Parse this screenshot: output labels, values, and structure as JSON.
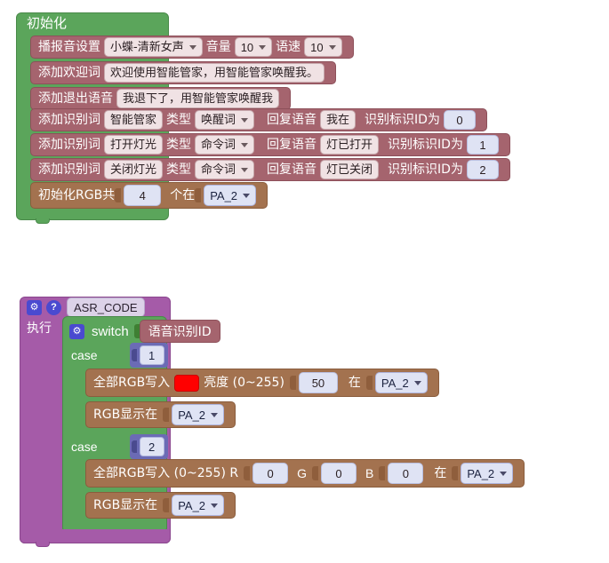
{
  "app": {
    "type": "block-programming-canvas",
    "background": "#ffffff"
  },
  "colors": {
    "hat_green": "#5ba55b",
    "speech_maroon": "#a5646e",
    "rgb_brown": "#a3724f",
    "event_purple": "#a55ba8",
    "value_blue": "#dfe3f4",
    "red_swatch": "#ff0000"
  },
  "groups": [
    {
      "id": "init-group",
      "hat": {
        "label": "初始化"
      },
      "statements": [
        {
          "id": "voice-setting",
          "label": "播报音设置",
          "fields": [
            {
              "kind": "dropdown",
              "value": "小蝶-清新女声"
            },
            {
              "kind": "label",
              "value": "音量"
            },
            {
              "kind": "dropdown",
              "value": "10"
            },
            {
              "kind": "label",
              "value": "语速"
            },
            {
              "kind": "dropdown",
              "value": "10"
            }
          ]
        },
        {
          "id": "welcome-word",
          "label": "添加欢迎词",
          "fields": [
            {
              "kind": "text",
              "value": "欢迎使用智能管家，用智能管家唤醒我。"
            }
          ]
        },
        {
          "id": "exit-voice",
          "label": "添加退出语音",
          "fields": [
            {
              "kind": "text",
              "value": "我退下了，用智能管家唤醒我"
            }
          ]
        },
        {
          "id": "keyword-0",
          "label": "添加识别词",
          "fields": [
            {
              "kind": "text",
              "value": "智能管家"
            },
            {
              "kind": "label",
              "value": "类型"
            },
            {
              "kind": "dropdown",
              "value": "唤醒词"
            },
            {
              "kind": "label",
              "value": "回复语音"
            },
            {
              "kind": "text",
              "value": "我在"
            },
            {
              "kind": "label",
              "value": "识别标识ID为"
            },
            {
              "kind": "num",
              "value": "0"
            }
          ]
        },
        {
          "id": "keyword-1",
          "label": "添加识别词",
          "fields": [
            {
              "kind": "text",
              "value": "打开灯光"
            },
            {
              "kind": "label",
              "value": "类型"
            },
            {
              "kind": "dropdown",
              "value": "命令词"
            },
            {
              "kind": "label",
              "value": "回复语音"
            },
            {
              "kind": "text",
              "value": "灯已打开"
            },
            {
              "kind": "label",
              "value": "识别标识ID为"
            },
            {
              "kind": "num",
              "value": "1"
            }
          ]
        },
        {
          "id": "keyword-2",
          "label": "添加识别词",
          "fields": [
            {
              "kind": "text",
              "value": "关闭灯光"
            },
            {
              "kind": "label",
              "value": "类型"
            },
            {
              "kind": "dropdown",
              "value": "命令词"
            },
            {
              "kind": "label",
              "value": "回复语音"
            },
            {
              "kind": "text",
              "value": "灯已关闭"
            },
            {
              "kind": "label",
              "value": "识别标识ID为"
            },
            {
              "kind": "num",
              "value": "2"
            }
          ]
        },
        {
          "id": "rgb-init",
          "label": "初始化RGB共",
          "fields": [
            {
              "kind": "num",
              "value": "4"
            },
            {
              "kind": "label",
              "value": "个在"
            },
            {
              "kind": "dropdown",
              "value": "PA_2"
            }
          ]
        }
      ]
    },
    {
      "id": "asr-group",
      "header": {
        "gear_icon": "gear-icon",
        "help_icon": "help-icon",
        "title": "ASR_CODE",
        "exec_label": "执行"
      },
      "switch": {
        "gear_icon": "gear-icon",
        "label": "switch",
        "variable": "语音识别ID",
        "cases": [
          {
            "case_label": "case",
            "case_value": "1",
            "body": [
              {
                "id": "rgb-write-color-1",
                "label": "全部RGB写入",
                "fields": [
                  {
                    "kind": "color",
                    "value": "#ff0000"
                  },
                  {
                    "kind": "label",
                    "value": "亮度 (0~255)"
                  },
                  {
                    "kind": "num",
                    "value": "50"
                  },
                  {
                    "kind": "label",
                    "value": "在"
                  },
                  {
                    "kind": "dropdown",
                    "value": "PA_2"
                  }
                ]
              },
              {
                "id": "rgb-show-1",
                "label": "RGB显示在",
                "fields": [
                  {
                    "kind": "dropdown",
                    "value": "PA_2"
                  }
                ]
              }
            ]
          },
          {
            "case_label": "case",
            "case_value": "2",
            "body": [
              {
                "id": "rgb-write-rgb-2",
                "label": "全部RGB写入 (0~255) R",
                "fields": [
                  {
                    "kind": "num",
                    "value": "0"
                  },
                  {
                    "kind": "label",
                    "value": "G"
                  },
                  {
                    "kind": "num",
                    "value": "0"
                  },
                  {
                    "kind": "label",
                    "value": "B"
                  },
                  {
                    "kind": "num",
                    "value": "0"
                  },
                  {
                    "kind": "label",
                    "value": "在"
                  },
                  {
                    "kind": "dropdown",
                    "value": "PA_2"
                  }
                ]
              },
              {
                "id": "rgb-show-2",
                "label": "RGB显示在",
                "fields": [
                  {
                    "kind": "dropdown",
                    "value": "PA_2"
                  }
                ]
              }
            ]
          }
        ]
      }
    }
  ]
}
